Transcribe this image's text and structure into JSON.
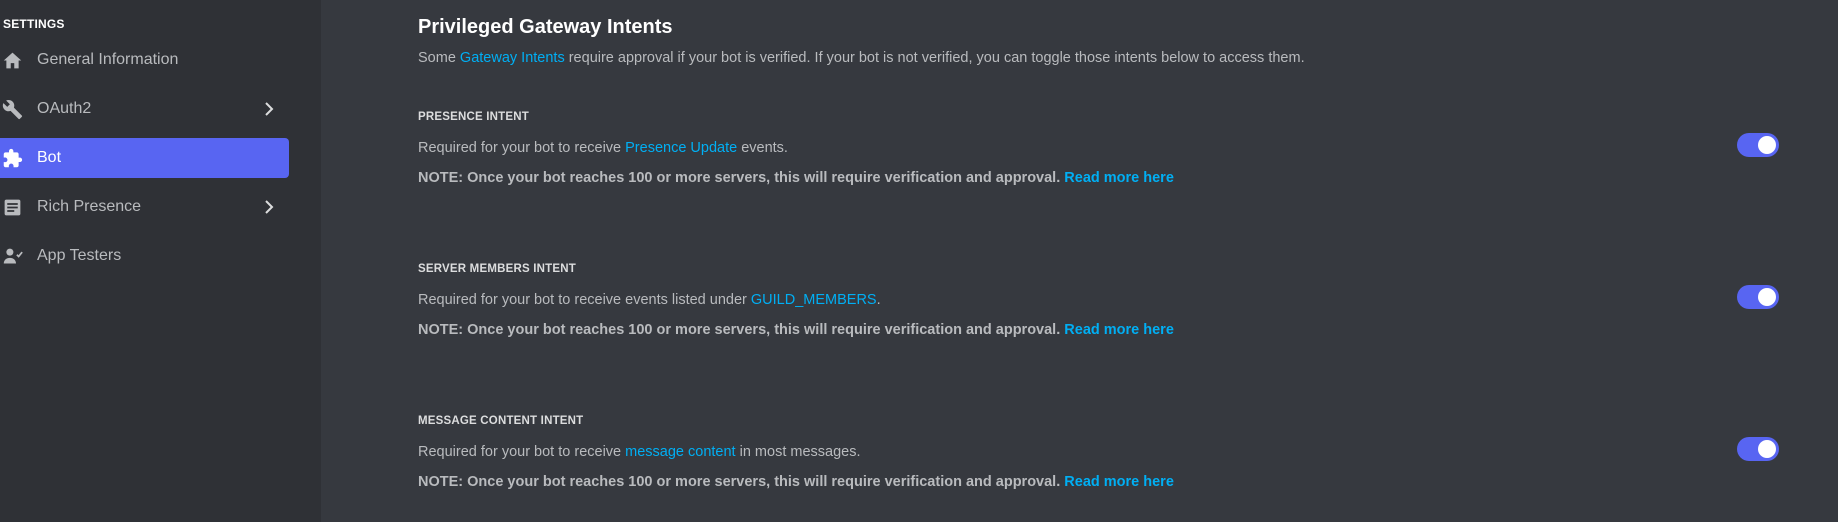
{
  "sidebar": {
    "heading": "SETTINGS",
    "items": [
      {
        "label": "General Information",
        "icon": "home-icon",
        "active": false,
        "has_chevron": false
      },
      {
        "label": "OAuth2",
        "icon": "wrench-icon",
        "active": false,
        "has_chevron": true
      },
      {
        "label": "Bot",
        "icon": "puzzle-icon",
        "active": true,
        "has_chevron": false
      },
      {
        "label": "Rich Presence",
        "icon": "document-icon",
        "active": false,
        "has_chevron": true
      },
      {
        "label": "App Testers",
        "icon": "person-icon",
        "active": false,
        "has_chevron": false
      }
    ]
  },
  "main": {
    "title": "Privileged Gateway Intents",
    "description": {
      "prefix": "Some ",
      "link": "Gateway Intents",
      "suffix": " require approval if your bot is verified. If your bot is not verified, you can toggle those intents below to access them."
    },
    "intents": [
      {
        "heading": "PRESENCE INTENT",
        "desc_prefix": "Required for your bot to receive ",
        "desc_link": "Presence Update",
        "desc_suffix": " events.",
        "note": "NOTE: Once your bot reaches 100 or more servers, this will require verification and approval. ",
        "note_link": "Read more here",
        "enabled": true
      },
      {
        "heading": "SERVER MEMBERS INTENT",
        "desc_prefix": "Required for your bot to receive events listed under ",
        "desc_link": "GUILD_MEMBERS",
        "desc_suffix": ".",
        "note": "NOTE: Once your bot reaches 100 or more servers, this will require verification and approval. ",
        "note_link": "Read more here",
        "enabled": true
      },
      {
        "heading": "MESSAGE CONTENT INTENT",
        "desc_prefix": "Required for your bot to receive ",
        "desc_link": "message content",
        "desc_suffix": " in most messages.",
        "note": "NOTE: Once your bot reaches 100 or more servers, this will require verification and approval. ",
        "note_link": "Read more here",
        "enabled": true
      }
    ]
  },
  "colors": {
    "sidebar_bg": "#2f3136",
    "main_bg": "#36393f",
    "accent": "#5865f2",
    "link": "#00aff4"
  }
}
